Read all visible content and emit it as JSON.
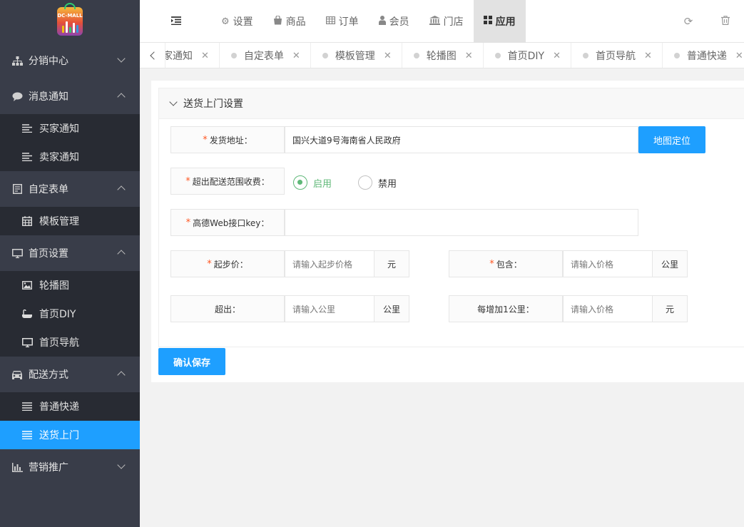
{
  "logo": {
    "text": "DC-MALL"
  },
  "sidebar": {
    "groups": [
      {
        "label": "分销中心",
        "icon": "sitemap-icon",
        "open": false,
        "items": []
      },
      {
        "label": "消息通知",
        "icon": "comment-icon",
        "open": true,
        "items": [
          {
            "label": "买家通知",
            "icon": "align-left-icon"
          },
          {
            "label": "卖家通知",
            "icon": "align-left-icon"
          }
        ]
      },
      {
        "label": "自定表单",
        "icon": "form-icon",
        "open": true,
        "items": [
          {
            "label": "模板管理",
            "icon": "calendar-icon"
          }
        ]
      },
      {
        "label": "首页设置",
        "icon": "monitor-icon",
        "open": true,
        "items": [
          {
            "label": "轮播图",
            "icon": "image-icon"
          },
          {
            "label": "首页DIY",
            "icon": "bath-icon"
          },
          {
            "label": "首页导航",
            "icon": "monitor-icon"
          }
        ]
      },
      {
        "label": "配送方式",
        "icon": "car-icon",
        "open": true,
        "items": [
          {
            "label": "普通快递",
            "icon": "list-icon"
          },
          {
            "label": "送货上门",
            "icon": "list-icon",
            "active": true
          }
        ]
      },
      {
        "label": "营销推广",
        "icon": "bar-chart-icon",
        "open": false,
        "items": []
      }
    ]
  },
  "header": {
    "nav": [
      {
        "label": "设置",
        "icon": "cogs-icon"
      },
      {
        "label": "商品",
        "icon": "shopping-bag-icon"
      },
      {
        "label": "订单",
        "icon": "table-icon"
      },
      {
        "label": "会员",
        "icon": "user-icon"
      },
      {
        "label": "门店",
        "icon": "bank-icon"
      },
      {
        "label": "应用",
        "icon": "grid-icon",
        "active": true
      }
    ],
    "right": [
      {
        "icon": "refresh-icon",
        "glyph": "⟳"
      },
      {
        "icon": "trash-icon",
        "glyph": "🗑"
      }
    ]
  },
  "tabs": [
    {
      "label": "家通知",
      "first": true
    },
    {
      "label": "自定表单"
    },
    {
      "label": "模板管理"
    },
    {
      "label": "轮播图"
    },
    {
      "label": "首页DIY"
    },
    {
      "label": "首页导航"
    },
    {
      "label": "普通快递"
    }
  ],
  "panel": {
    "title": "送货上门设置",
    "fields": {
      "address": {
        "label": "发货地址：",
        "value": "国兴大道9号海南省人民政府",
        "button": "地图定位"
      },
      "overrange": {
        "label": "超出配送范围收费：",
        "options": [
          "启用",
          "禁用"
        ],
        "selected": "启用"
      },
      "amap_key": {
        "label": "高德Web接口key：",
        "value": ""
      },
      "start_price": {
        "label": "起步价：",
        "placeholder": "请输入起步价格",
        "unit": "元"
      },
      "include": {
        "label": "包含：",
        "placeholder": "请输入价格",
        "unit": "公里"
      },
      "exceed": {
        "label": "超出：",
        "placeholder": "请输入公里",
        "unit": "公里"
      },
      "per_km": {
        "label": "每增加1公里：",
        "placeholder": "请输入价格",
        "unit": "元"
      }
    },
    "save_label": "确认保存"
  }
}
